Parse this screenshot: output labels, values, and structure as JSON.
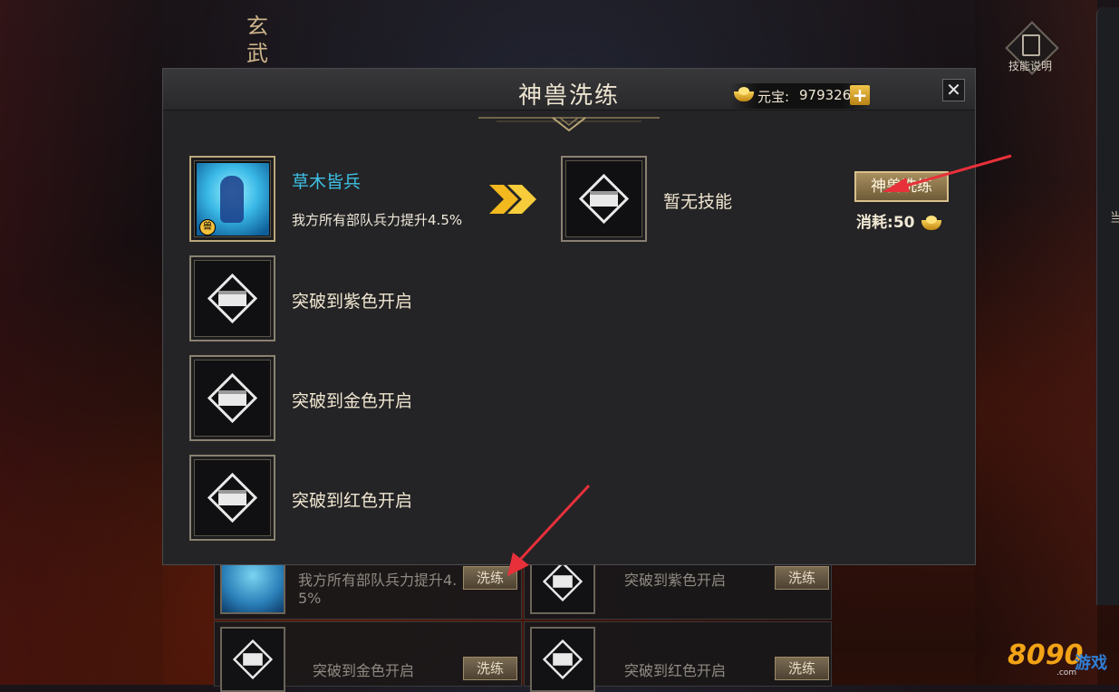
{
  "background": {
    "title_chars": [
      "玄",
      "武"
    ],
    "skill_info_label": "技能说明",
    "right_strip_char": "当"
  },
  "underlying_list": {
    "rows": [
      {
        "desc": "我方所有部队兵力提升4.\n5%",
        "button": "洗练",
        "has_art": true
      },
      {
        "desc": "突破到紫色开启",
        "button": "洗练",
        "has_art": false
      },
      {
        "desc": "突破到金色开启",
        "button": "洗练",
        "has_art": false
      },
      {
        "desc": "突破到红色开启",
        "button": "洗练",
        "has_art": false
      }
    ]
  },
  "dialog": {
    "title": "神兽洗练",
    "currency": {
      "label": "元宝:",
      "value": "979326",
      "plus": "+"
    },
    "close": "✕",
    "current_skill": {
      "name": "草木皆兵",
      "desc": "我方所有部队兵力提升4.5%",
      "badge": "兽"
    },
    "locked_slots": [
      {
        "text": "突破到紫色开启"
      },
      {
        "text": "突破到金色开启"
      },
      {
        "text": "突破到红色开启"
      }
    ],
    "result_slot": {
      "text": "暂无技能"
    },
    "wash_button": "神兽洗练",
    "cost": {
      "label": "消耗:",
      "value": "50"
    }
  },
  "watermark": {
    "number": "8090",
    "game": "游戏",
    "domain": ".com"
  },
  "colors": {
    "skill_name": "#3fc1e6",
    "gold": "#f2c44a",
    "annotation_arrow": "#e8303a"
  }
}
